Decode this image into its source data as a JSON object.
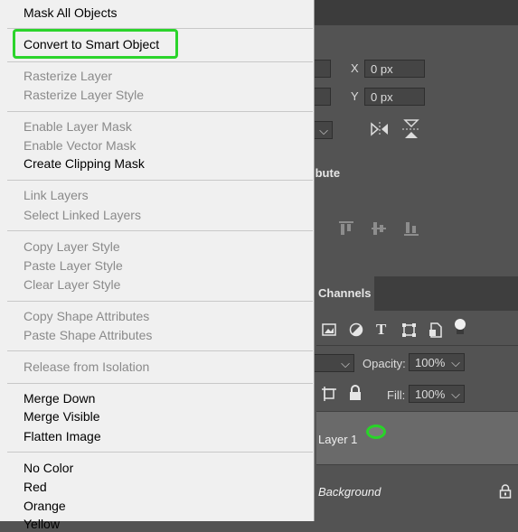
{
  "menu": {
    "items": [
      {
        "label": "Mask All Objects",
        "enabled": true
      },
      {
        "label": "Convert to Smart Object",
        "enabled": true,
        "highlighted": true
      },
      {
        "label": "Rasterize Layer",
        "enabled": false
      },
      {
        "label": "Rasterize Layer Style",
        "enabled": false
      },
      {
        "label": "Enable Layer Mask",
        "enabled": false
      },
      {
        "label": "Enable Vector Mask",
        "enabled": false
      },
      {
        "label": "Create Clipping Mask",
        "enabled": true
      },
      {
        "label": "Link Layers",
        "enabled": false
      },
      {
        "label": "Select Linked Layers",
        "enabled": false
      },
      {
        "label": "Copy Layer Style",
        "enabled": false
      },
      {
        "label": "Paste Layer Style",
        "enabled": false
      },
      {
        "label": "Clear Layer Style",
        "enabled": false
      },
      {
        "label": "Copy Shape Attributes",
        "enabled": false
      },
      {
        "label": "Paste Shape Attributes",
        "enabled": false
      },
      {
        "label": "Release from Isolation",
        "enabled": false
      },
      {
        "label": "Merge Down",
        "enabled": true
      },
      {
        "label": "Merge Visible",
        "enabled": true
      },
      {
        "label": "Flatten Image",
        "enabled": true
      },
      {
        "label": "No Color",
        "enabled": true
      },
      {
        "label": "Red",
        "enabled": true
      },
      {
        "label": "Orange",
        "enabled": true
      },
      {
        "label": "Yellow",
        "enabled": true
      }
    ]
  },
  "properties": {
    "x_label": "X",
    "x_value": "0 px",
    "y_label": "Y",
    "y_value": "0 px",
    "section_title": "ibute"
  },
  "layers": {
    "tab_label": "Channels",
    "opacity_label": "Opacity:",
    "opacity_value": "100%",
    "fill_label": "Fill:",
    "fill_value": "100%",
    "layer1_name": "Layer 1",
    "background_name": "Background"
  },
  "colors": {
    "highlight_green": "#2bd42b",
    "menu_bg": "#f0f0f0",
    "panel_bg": "#535353"
  }
}
